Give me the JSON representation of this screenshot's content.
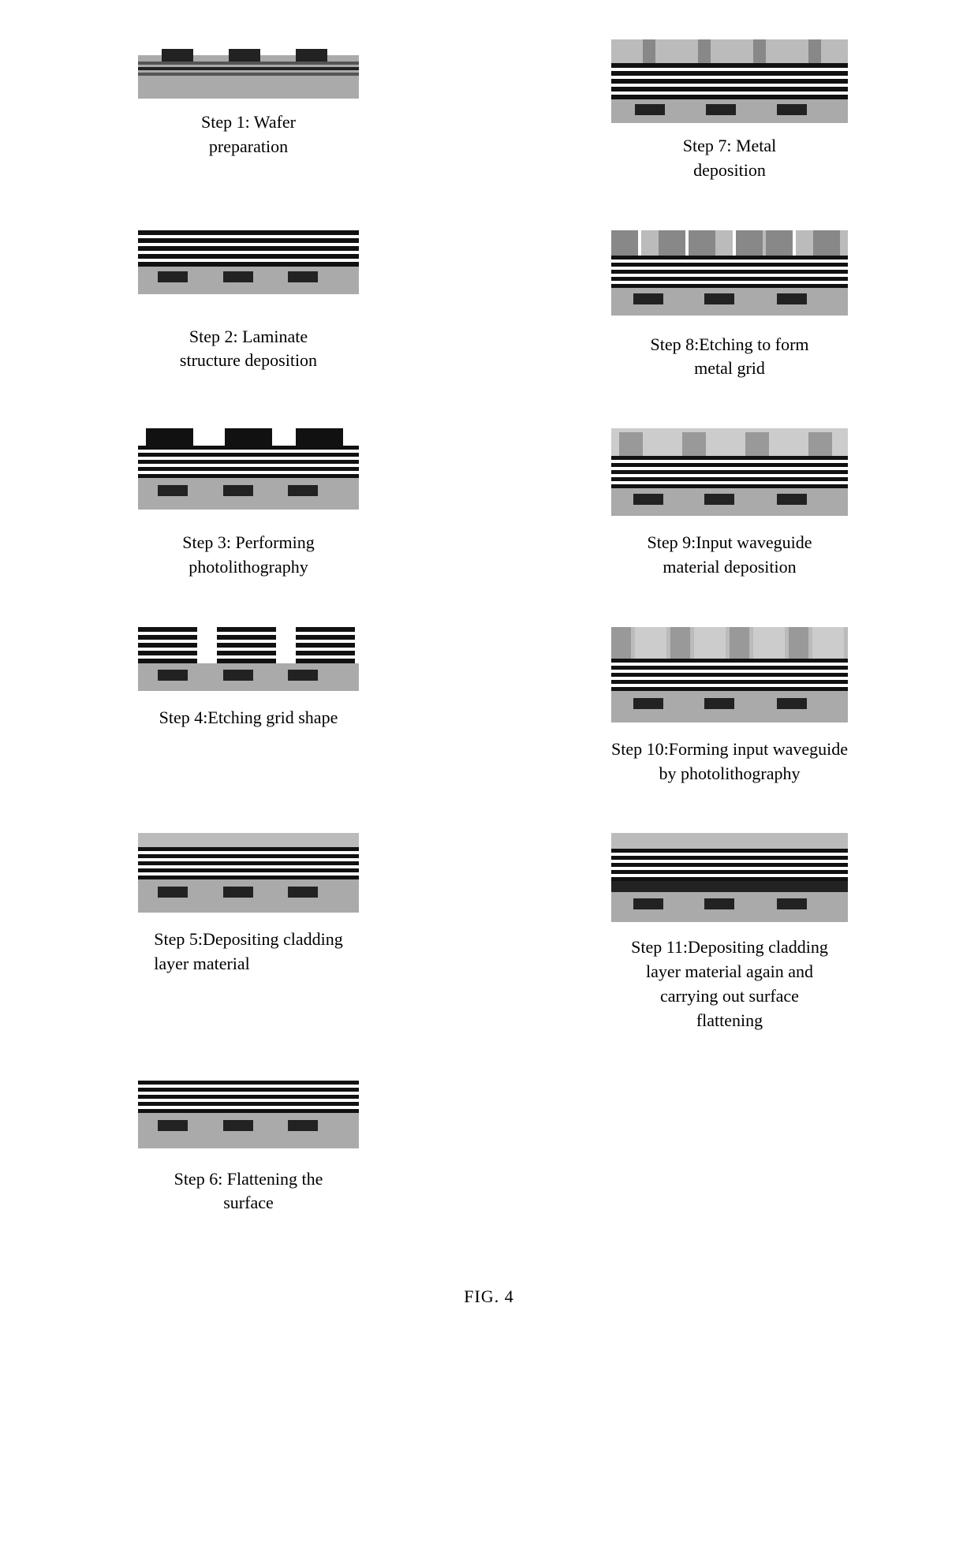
{
  "title": "FIG. 4",
  "steps": [
    {
      "id": "step1",
      "label": "Step 1: Wafer\npreparation",
      "col": "left"
    },
    {
      "id": "step7",
      "label": "Step 7: Metal\ndeposition",
      "col": "right"
    },
    {
      "id": "step2",
      "label": "Step 2: Laminate\nstructure deposition",
      "col": "left"
    },
    {
      "id": "step8",
      "label": "Step 8:Etching to form\nmetal grid",
      "col": "right"
    },
    {
      "id": "step3",
      "label": "Step 3: Performing\nphotolithography",
      "col": "left"
    },
    {
      "id": "step9",
      "label": "Step 9:Input waveguide\nmaterial deposition",
      "col": "right"
    },
    {
      "id": "step4",
      "label": "Step 4:Etching grid shape",
      "col": "left"
    },
    {
      "id": "step10",
      "label": "Step 10:Forming input waveguide\nby photolithography",
      "col": "right"
    },
    {
      "id": "step5",
      "label": "Step 5:Depositing cladding\nlayer material",
      "col": "left"
    },
    {
      "id": "step11",
      "label": "Step 11:Depositing cladding\nlayer material again and\ncarrying out surface\nflattening",
      "col": "right"
    },
    {
      "id": "step6",
      "label": "Step 6: Flattening the\nsurface",
      "col": "left"
    }
  ],
  "fig_label": "FIG. 4"
}
